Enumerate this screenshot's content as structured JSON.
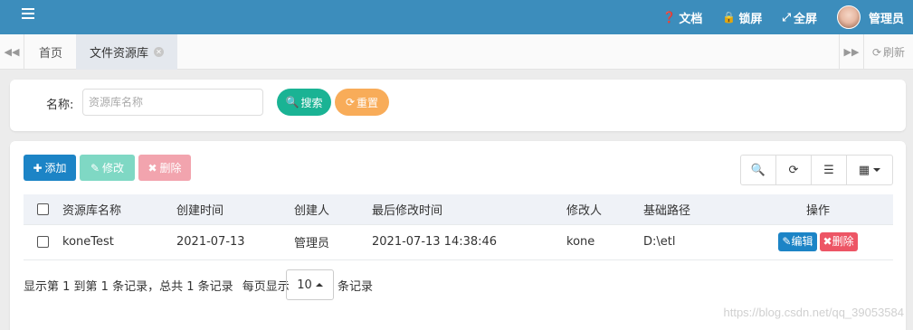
{
  "topbar": {
    "docs_label": "文档",
    "lock_label": "锁屏",
    "fullscreen_label": "全屏",
    "user_label": "管理员",
    "color": "#3c8dbc"
  },
  "tabs": {
    "home_label": "首页",
    "active_label": "文件资源库",
    "refresh_label": "刷新"
  },
  "search": {
    "label": "名称:",
    "placeholder": "资源库名称",
    "search_button": "搜索",
    "reset_button": "重置"
  },
  "toolbar": {
    "add_label": "添加",
    "edit_label": "修改",
    "delete_label": "删除"
  },
  "table": {
    "columns": [
      "资源库名称",
      "创建时间",
      "创建人",
      "最后修改时间",
      "修改人",
      "基础路径",
      "操作"
    ],
    "rows": [
      {
        "name": "koneTest",
        "created": "2021-07-13",
        "creator": "管理员",
        "modified": "2021-07-13 14:38:46",
        "modifier": "kone",
        "path": "D:\\etl",
        "edit_label": "编辑",
        "delete_label": "删除"
      }
    ]
  },
  "pagination": {
    "summary": "显示第 1 到第 1 条记录，总共 1 条记录",
    "per_page_prefix": "每页显示",
    "page_size": "10",
    "per_page_suffix": "条记录"
  },
  "watermark": "https://blog.csdn.net/qq_39053584"
}
